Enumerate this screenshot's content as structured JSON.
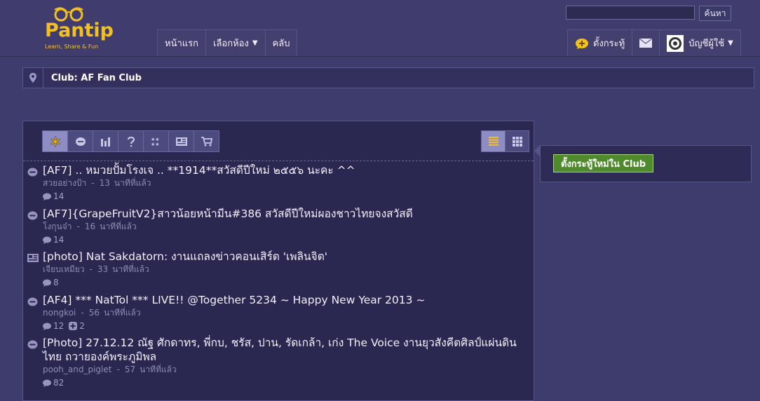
{
  "header": {
    "logo_text": "Pantip",
    "logo_tagline": "Learn, Share & Fun",
    "search_placeholder": "",
    "search_button": "ค้นหา",
    "nav_left": [
      {
        "label": "หน้าแรก",
        "caret": ""
      },
      {
        "label": "เลือกห้อง",
        "caret": "▼"
      },
      {
        "label": "คลับ",
        "caret": ""
      }
    ],
    "new_topic_label": "ตั้งกระทู้",
    "account_label": "บัญชีผู้ใช้",
    "account_caret": "▼"
  },
  "breadcrumb": {
    "text": "Club: AF Fan Club"
  },
  "sidebar": {
    "new_topic_button": "ตั้งกระทู้ใหม่ใน Club"
  },
  "topics": [
    {
      "title": "[AF7] .. หมวยปั้มโรงเจ .. **1914**สวัสดีปีใหม่ ๒๕๕๖ นะคะ ^^",
      "author": "สวยอย่างป้า",
      "minutes": "13",
      "ago": "นาทีที่แล้ว",
      "comments": "14",
      "votes": ""
    },
    {
      "title": "[AF7]{GrapeFruitV2}สาวน้อยหน้ามีน#386 สวัสดีปีใหม่ผองชาวไทยจงสวัสดี",
      "author": "โงกุนจ๋า",
      "minutes": "16",
      "ago": "นาทีที่แล้ว",
      "comments": "14",
      "votes": ""
    },
    {
      "title": "[photo] Nat Sakdatorn: งานแถลงข่าวคอนเสิร์ต 'เพลินจิต'",
      "author": "เจียบเหมียว",
      "minutes": "33",
      "ago": "นาทีที่แล้ว",
      "comments": "8",
      "votes": ""
    },
    {
      "title": "[AF4] *** NatTol *** LIVE!! @Together 5234 ~ Happy New Year 2013 ~",
      "author": "nongkoi",
      "minutes": "56",
      "ago": "นาทีที่แล้ว",
      "comments": "12",
      "votes": "2"
    },
    {
      "title": "[Photo] 27.12.12 ณัฐ ศักดาทร, พี่กบ, ชรัส, ปาน, รัดเกล้า, เก่ง The Voice งานยุวสังคีตศิลป์แผ่นดินไทย ถวายองค์พระภูมิพล",
      "author": "pooh_and_piglet",
      "minutes": "57",
      "ago": "นาทีที่แล้ว",
      "comments": "82",
      "votes": ""
    }
  ],
  "colors": {
    "accent_green": "#4f8a2c",
    "logo_yellow": "#f3c021"
  }
}
